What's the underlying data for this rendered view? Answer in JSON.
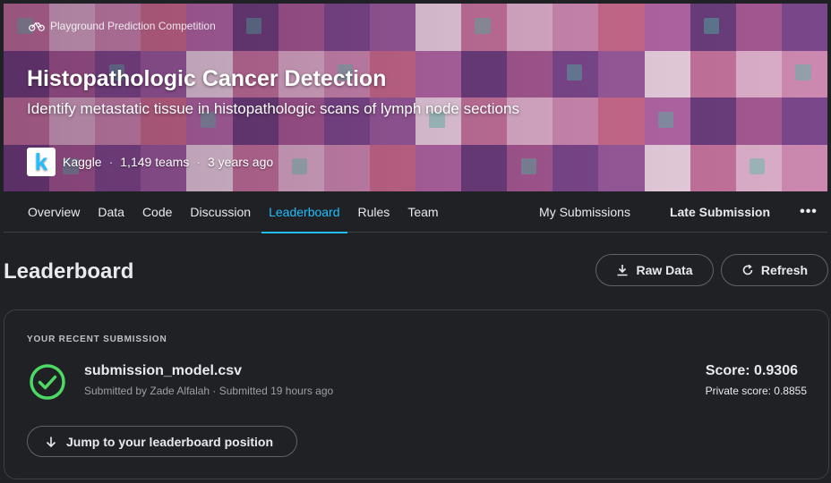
{
  "banner": {
    "competition_type": "Playground Prediction Competition",
    "title": "Histopathologic Cancer Detection",
    "subtitle": "Identify metastatic tissue in histopathologic scans of lymph node sections",
    "host_logo_letter": "k",
    "host": "Kaggle",
    "separator": "·",
    "teams": "1,149 teams",
    "age": "3 years ago",
    "tile_colors": [
      "#c9779f",
      "#7d4a8e",
      "#b56aa8",
      "#e3b6cf",
      "#9c5ea0",
      "#6b3f7d",
      "#d48fb6",
      "#f0d9e6",
      "#a85b94",
      "#cf6e8d"
    ]
  },
  "tabs": {
    "items": [
      {
        "label": "Overview",
        "active": false
      },
      {
        "label": "Data",
        "active": false
      },
      {
        "label": "Code",
        "active": false
      },
      {
        "label": "Discussion",
        "active": false
      },
      {
        "label": "Leaderboard",
        "active": true
      },
      {
        "label": "Rules",
        "active": false
      },
      {
        "label": "Team",
        "active": false
      }
    ],
    "my_submissions": "My Submissions",
    "late_submission": "Late Submission",
    "more": "•••"
  },
  "leaderboard": {
    "title": "Leaderboard",
    "raw_data_label": "Raw Data",
    "refresh_label": "Refresh"
  },
  "recent_submission": {
    "label": "YOUR RECENT SUBMISSION",
    "file_name": "submission_model.csv",
    "submitted_text": "Submitted by Zade Alfalah · Submitted 19 hours ago",
    "score": "Score: 0.9306",
    "private_score": "Private score: 0.8855",
    "jump_label": "Jump to your leaderboard position"
  },
  "colors": {
    "accent": "#20beff",
    "success": "#4cd964",
    "background": "#202124"
  }
}
